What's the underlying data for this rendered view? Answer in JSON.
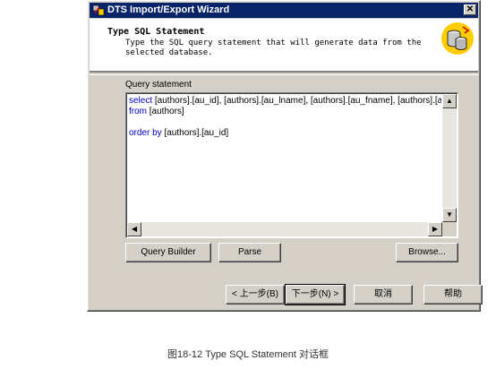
{
  "window": {
    "title": "DTS Import/Export Wizard",
    "close_glyph": "✕",
    "app_icon": "dts-wizard-icon"
  },
  "header": {
    "title": "Type SQL Statement",
    "description_line1": "Type the SQL query statement that will generate data from the",
    "description_line2": "selected database.",
    "icon": "database-icon"
  },
  "query": {
    "label": "Query statement",
    "lines": [
      {
        "keyword": "select",
        "text": " [authors].[au_id], [authors].[au_lname], [authors].[au_fname], [authors].[addre"
      },
      {
        "keyword": "from",
        "text": " [authors]"
      },
      {
        "keyword": "",
        "text": ""
      },
      {
        "keyword": "order by",
        "text": " [authors].[au_id]"
      }
    ]
  },
  "buttons": {
    "query_builder": "Query Builder",
    "parse": "Parse",
    "browse": "Browse...",
    "back": "< 上一步(B)",
    "next": "下一步(N) >",
    "cancel": "取消",
    "help": "帮助"
  },
  "caption": "图18-12  Type SQL Statement 对话框"
}
